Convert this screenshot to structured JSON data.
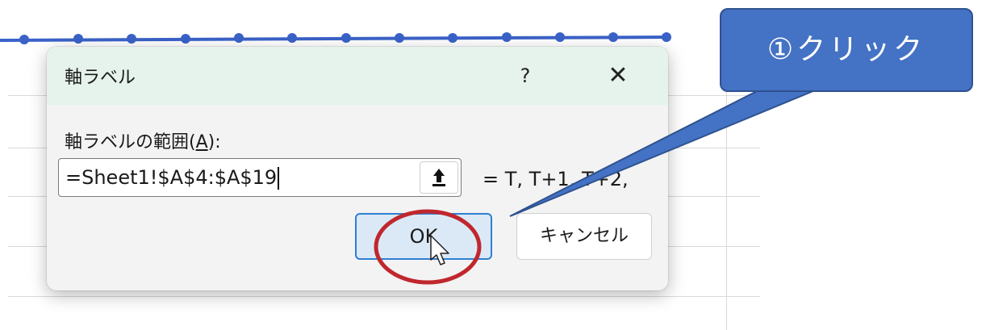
{
  "dialog": {
    "title": "軸ラベル",
    "help_label": "?",
    "close_label": "✕",
    "range_label_prefix": "軸ラベルの範囲(",
    "range_label_key": "A",
    "range_label_suffix": "):",
    "range_value": "=Sheet1!$A$4:$A$19",
    "preview": "= T, T+1, T+2,",
    "ok_label": "OK",
    "cancel_label": "キャンセル"
  },
  "annotation": {
    "callout_text": "①クリック",
    "callout_color": "#4472c4",
    "circle_color": "#c0272d"
  },
  "chart": {
    "line_color": "#3a62c8"
  }
}
